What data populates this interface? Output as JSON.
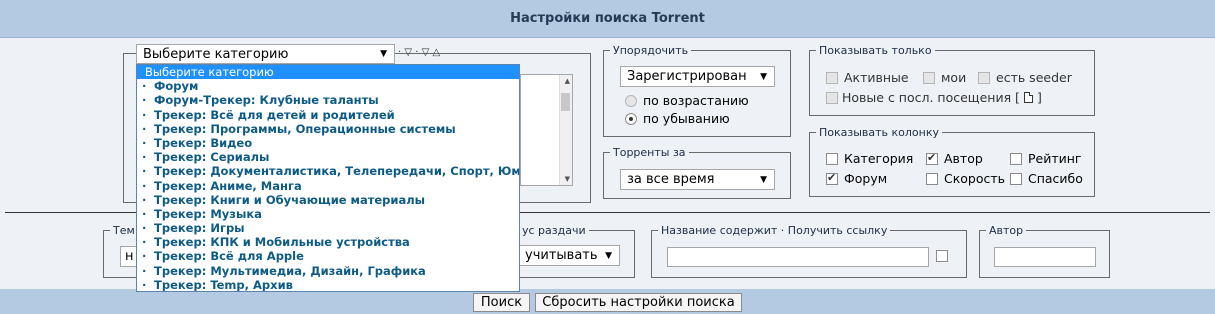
{
  "header": {
    "title": "Настройки поиска Torrent"
  },
  "category": {
    "selected": "Выберите категорию",
    "icon_arrows": "· ▽ · ▽ △"
  },
  "dropdown": {
    "options": [
      "Выберите категорию",
      "Форум",
      "Форум-Трекер: Клубные таланты",
      "Трекер: Всё для детей и родителей",
      "Трекер: Программы, Операционные системы",
      "Трекер: Видео",
      "Трекер: Сериалы",
      "Трекер: Документалистика, Телепередачи, Спорт, Юмор",
      "Трекер: Аниме, Манга",
      "Трекер: Книги и Обучающие материалы",
      "Трекер: Музыка",
      "Трекер: Игры",
      "Трекер: КПК и Мобильные устройства",
      "Трекер: Всё для Apple",
      "Трекер: Мультимедиа, Дизайн, Графика",
      "Трекер: Temp, Архив"
    ]
  },
  "order": {
    "legend": "Упорядочить",
    "selected": "Зарегистрирован",
    "asc": "по возрастанию",
    "desc": "по убыванию"
  },
  "period": {
    "legend": "Торренты за",
    "selected": "за все время"
  },
  "show_only": {
    "legend": "Показывать только",
    "active": "Активные",
    "mine": "мои",
    "has_seeder": "есть seeder",
    "new_since": "Новые с посл. посещения [",
    "new_since_end": "]"
  },
  "show_columns": {
    "legend": "Показывать колонку",
    "category": "Категория",
    "author": "Автор",
    "rating": "Рейтинг",
    "forum": "Форум",
    "speed": "Скорость",
    "thanks": "Спасибо"
  },
  "lower": {
    "topic_legend_partial": "Тем",
    "topic_select_partial": "н",
    "status_legend_partial": "ус раздачи",
    "status_selected": "учитывать",
    "title_contains_legend": "Название содержит",
    "get_link": "Получить ссылку",
    "author_legend": "Автор"
  },
  "buttons": {
    "search": "Поиск",
    "reset": "Сбросить настройки поиска"
  }
}
